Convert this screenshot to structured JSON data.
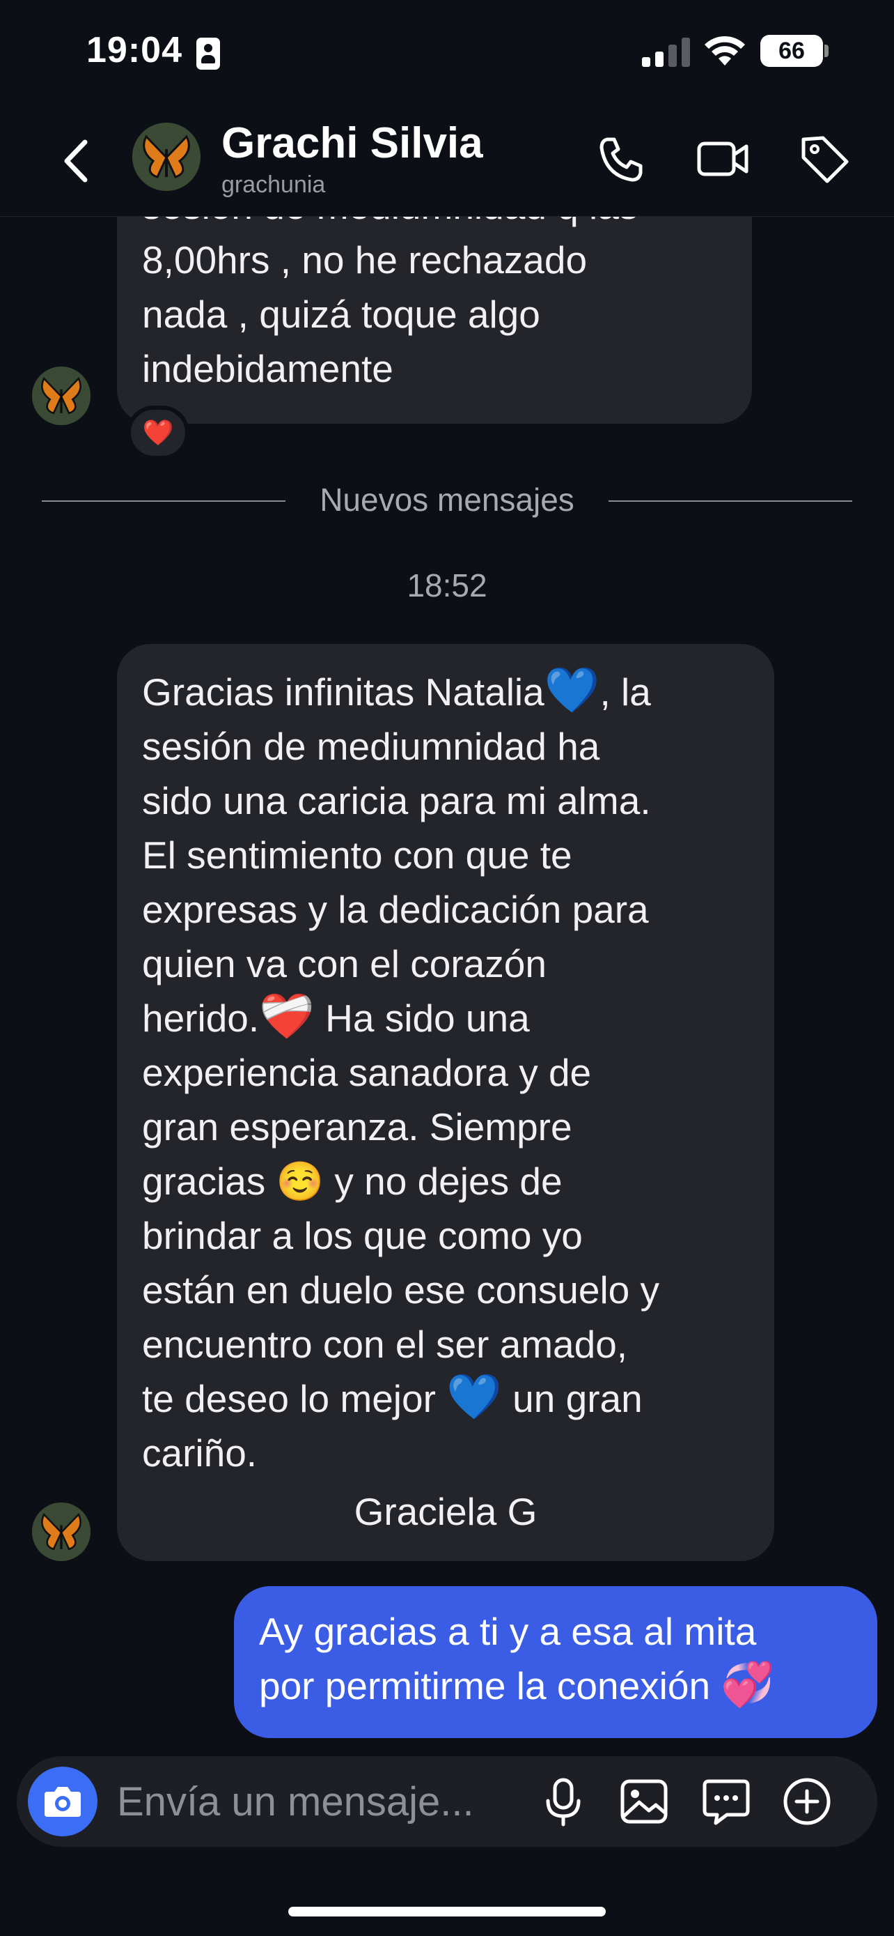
{
  "status_bar": {
    "time": "19:04",
    "battery": "66"
  },
  "header": {
    "name": "Grachi Silvia",
    "handle": "grachunia",
    "icons": [
      "back-chevron-icon",
      "phone-icon",
      "video-icon",
      "tag-icon"
    ]
  },
  "messages": {
    "partial_incoming": {
      "lines": [
        "sesión de mediumnidad q las",
        "8,00hrs , no he rechazado",
        "nada  , quizá toque algo",
        "indebidamente"
      ],
      "reaction": "❤️"
    },
    "divider_label": "Nuevos mensajes",
    "timestamp": "18:52",
    "incoming": {
      "line1_text": "Gracias infinitas Natalia",
      "line1_emoji": "💙",
      "line1_after": ", la",
      "line2": "sesión de mediumnidad ha",
      "line3": "sido una  caricia para mi alma.",
      "line4": "El sentimiento con que te",
      "line5": "expresas y la dedicación para",
      "line6": "quien va con el corazón",
      "line7_text": "herido.",
      "line7_emoji": "❤️‍🩹",
      "line7_after": " Ha sido una",
      "line8": "experiencia sanadora y de",
      "line9": "gran esperanza. Siempre",
      "line10_text": "gracias ",
      "line10_emoji": "☺️",
      "line10_after": " y no dejes de",
      "line11": "brindar a los que como yo",
      "line12": "están en duelo ese consuelo y",
      "line13": "encuentro con el ser amado,",
      "line14_text": "te deseo lo mejor ",
      "line14_emoji": "💙",
      "line14_after": " un gran",
      "line15": "cariño.",
      "signature": "Graciela  G"
    },
    "outgoing": {
      "line1": "Ay gracias a ti y a esa al mita",
      "line2_text": "por permitirme la conexión ",
      "line2_emoji": "💞"
    }
  },
  "composer": {
    "placeholder": "Envía un mensaje...",
    "icons": [
      "camera-icon",
      "microphone-icon",
      "gallery-icon",
      "sticker-chat-icon",
      "add-icon"
    ]
  },
  "colors": {
    "background": "#0c0f16",
    "incoming_bubble": "#23252b",
    "outgoing_bubble": "#3b5de6",
    "camera_button": "#3b6ef5"
  }
}
